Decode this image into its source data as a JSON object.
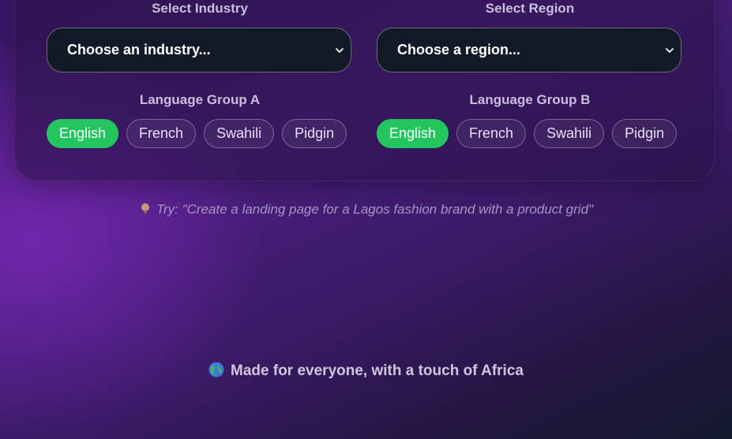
{
  "industry": {
    "label": "Select Industry",
    "selected": "Choose an industry..."
  },
  "region": {
    "label": "Select Region",
    "selected": "Choose a region..."
  },
  "language_group_a": {
    "label": "Language Group A",
    "options": [
      "English",
      "French",
      "Swahili",
      "Pidgin"
    ],
    "selected": "English"
  },
  "language_group_b": {
    "label": "Language Group B",
    "options": [
      "English",
      "French",
      "Swahili",
      "Pidgin"
    ],
    "selected": "English"
  },
  "hint": {
    "icon": "lightbulb-icon",
    "text": "Try: \"Create a landing page for a Lagos fashion brand with a product grid\""
  },
  "footer": {
    "icon": "globe-icon",
    "text": "Made for everyone, with a touch of Africa"
  },
  "colors": {
    "accent": "#22c55e",
    "select_bg": "#131a27"
  }
}
